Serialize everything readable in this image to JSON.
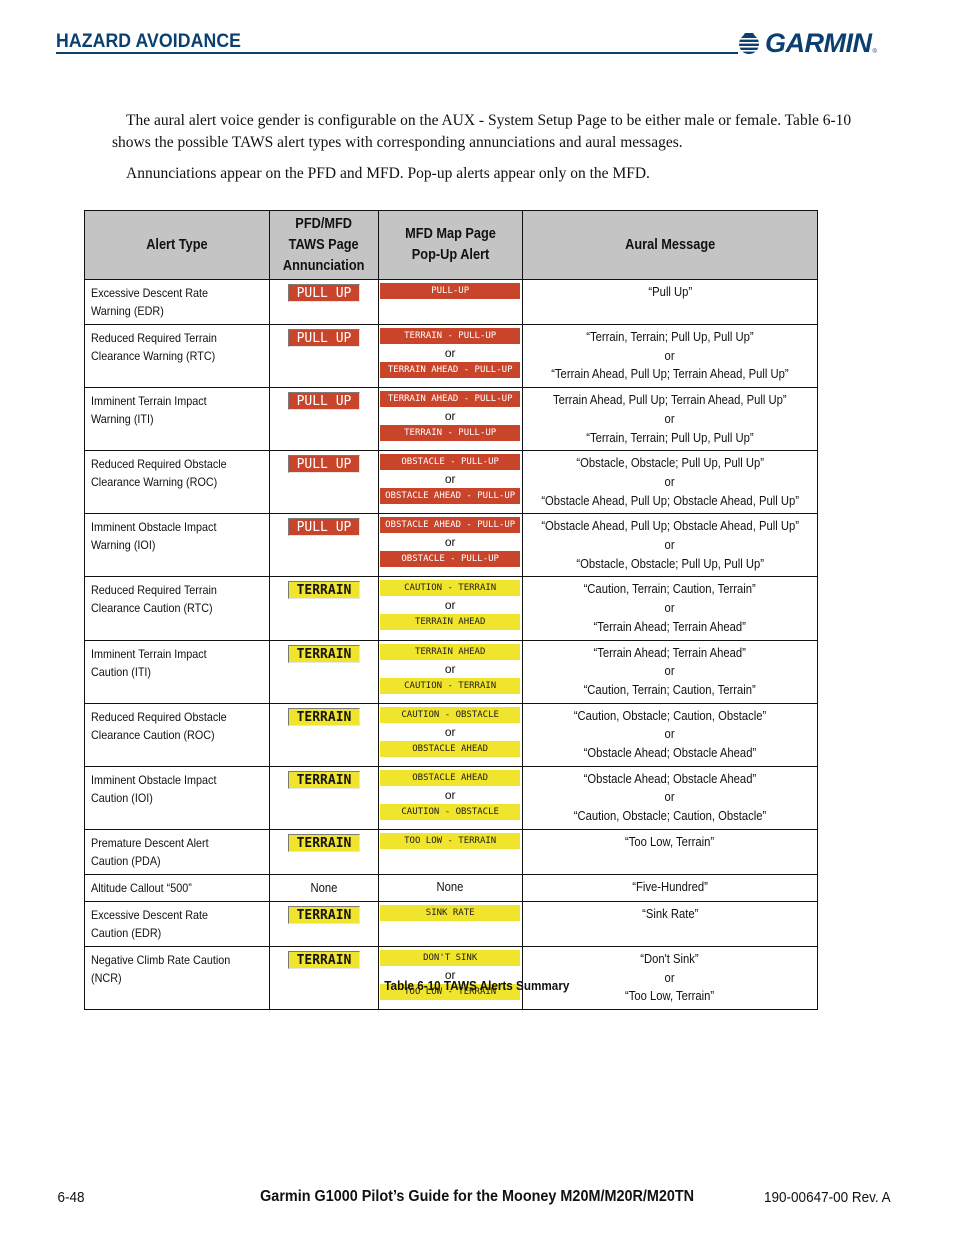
{
  "header": {
    "section_title": "HAZARD AVOIDANCE",
    "logo_text": "GARMIN",
    "logo_reg": "®"
  },
  "body": {
    "paragraph1": "The aural alert voice gender is configurable on the AUX - System Setup Page to be either male or female. Table 6-10 shows the possible TAWS alert types with corresponding annunciations and aural messages.",
    "paragraph2": "Annunciations appear on the PFD and MFD.  Pop-up alerts appear only on the MFD."
  },
  "table": {
    "headers": {
      "alert_type": "Alert Type",
      "annunciation": "PFD/MFD TAWS Page Annunciation",
      "popup": "MFD Map Page Pop-Up Alert",
      "aural": "Aural Message"
    },
    "or_text": "or",
    "colors": {
      "warning": "#c8452b",
      "caution": "#f0e42c"
    },
    "rows": [
      {
        "type": "Excessive Descent Rate Warning (EDR)",
        "annunciation": "PULL UP",
        "level": "warning",
        "popup1": "PULL-UP",
        "popup2": null,
        "aural1": "“Pull Up”",
        "aural2": null
      },
      {
        "type": "Reduced Required Terrain Clearance Warning (RTC)",
        "annunciation": "PULL UP",
        "level": "warning",
        "popup1": "TERRAIN - PULL-UP",
        "popup2": "TERRAIN AHEAD - PULL-UP",
        "aural1": "“Terrain, Terrain; Pull Up, Pull Up”",
        "aural2": "“Terrain Ahead, Pull Up; Terrain Ahead, Pull Up”"
      },
      {
        "type": "Imminent Terrain Impact Warning (ITI)",
        "annunciation": "PULL UP",
        "level": "warning",
        "popup1": "TERRAIN AHEAD - PULL-UP",
        "popup2": "TERRAIN - PULL-UP",
        "aural1": "Terrain Ahead, Pull Up; Terrain Ahead, Pull Up”",
        "aural2": "“Terrain, Terrain; Pull Up, Pull Up”"
      },
      {
        "type": "Reduced Required Obstacle Clearance Warning (ROC)",
        "annunciation": "PULL UP",
        "level": "warning",
        "popup1": "OBSTACLE - PULL-UP",
        "popup2": "OBSTACLE AHEAD - PULL-UP",
        "aural1": "“Obstacle, Obstacle; Pull Up, Pull Up”",
        "aural2": "“Obstacle Ahead, Pull Up; Obstacle Ahead, Pull Up”"
      },
      {
        "type": "Imminent Obstacle Impact Warning (IOI)",
        "annunciation": "PULL UP",
        "level": "warning",
        "popup1": "OBSTACLE AHEAD - PULL-UP",
        "popup2": "OBSTACLE - PULL-UP",
        "aural1": "“Obstacle Ahead, Pull Up; Obstacle Ahead, Pull Up”",
        "aural2": "“Obstacle, Obstacle; Pull Up, Pull Up”"
      },
      {
        "type": "Reduced Required Terrain Clearance Caution (RTC)",
        "annunciation": "TERRAIN",
        "level": "caution",
        "popup1": "CAUTION - TERRAIN",
        "popup2": "TERRAIN AHEAD",
        "aural1": "“Caution, Terrain; Caution, Terrain”",
        "aural2": "“Terrain Ahead; Terrain Ahead”"
      },
      {
        "type": "Imminent Terrain Impact Caution (ITI)",
        "annunciation": "TERRAIN",
        "level": "caution",
        "popup1": "TERRAIN AHEAD",
        "popup2": "CAUTION - TERRAIN",
        "aural1": "“Terrain Ahead; Terrain Ahead”",
        "aural2": "“Caution, Terrain; Caution, Terrain”"
      },
      {
        "type": "Reduced Required Obstacle Clearance Caution (ROC)",
        "annunciation": "TERRAIN",
        "level": "caution",
        "popup1": "CAUTION - OBSTACLE",
        "popup2": "OBSTACLE AHEAD",
        "aural1": "“Caution, Obstacle; Caution, Obstacle”",
        "aural2": "“Obstacle Ahead; Obstacle Ahead”"
      },
      {
        "type": "Imminent Obstacle Impact Caution (IOI)",
        "annunciation": "TERRAIN",
        "level": "caution",
        "popup1": "OBSTACLE AHEAD",
        "popup2": "CAUTION - OBSTACLE",
        "aural1": "“Obstacle Ahead; Obstacle Ahead”",
        "aural2": "“Caution, Obstacle; Caution, Obstacle”"
      },
      {
        "type": "Premature Descent Alert Caution (PDA)",
        "annunciation": "TERRAIN",
        "level": "caution",
        "popup1": "TOO LOW - TERRAIN",
        "popup2": null,
        "aural1": "“Too Low, Terrain”",
        "aural2": null
      },
      {
        "type": "Altitude Callout “500”",
        "annunciation": "None",
        "level": "none",
        "popup1": "None",
        "popup2": null,
        "aural1": "“Five-Hundred”",
        "aural2": null
      },
      {
        "type": "Excessive Descent Rate Caution (EDR)",
        "annunciation": "TERRAIN",
        "level": "caution",
        "popup1": "SINK RATE",
        "popup2": null,
        "aural1": "“Sink Rate”",
        "aural2": null
      },
      {
        "type": "Negative Climb Rate Caution (NCR)",
        "annunciation": "TERRAIN",
        "level": "caution",
        "popup1": "DON'T SINK",
        "popup2": "TOO LOW - TERRAIN",
        "aural1": "“Don't Sink”",
        "aural2": "“Too Low, Terrain”"
      }
    ],
    "caption": "Table 6-10  TAWS Alerts Summary"
  },
  "footer": {
    "page_number": "6-48",
    "title": "Garmin G1000 Pilot’s Guide for the Mooney M20M/M20R/M20TN",
    "doc_number": "190-00647-00 Rev. A"
  }
}
